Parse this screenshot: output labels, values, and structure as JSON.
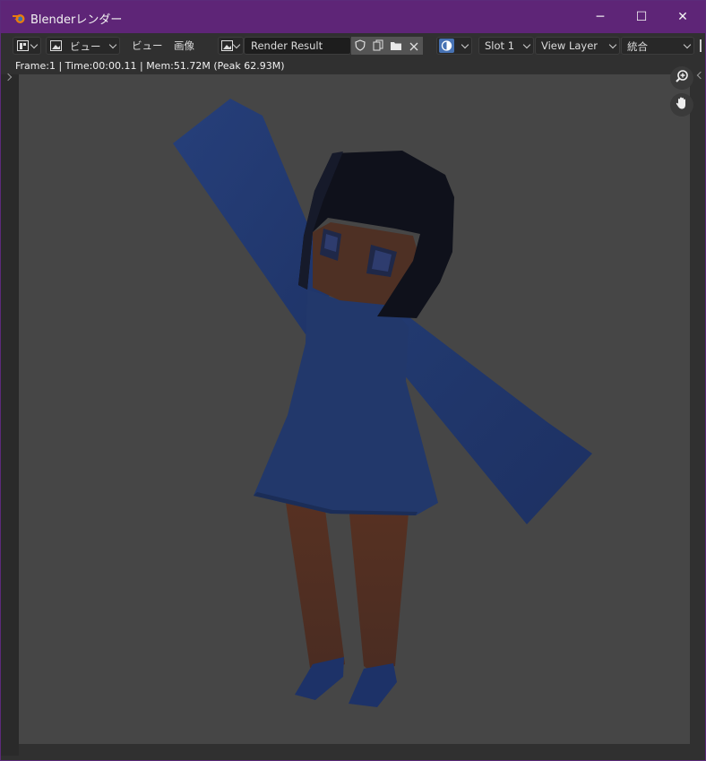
{
  "window": {
    "title": "Blenderレンダー",
    "controls": {
      "minimize": "─",
      "maximize": "☐",
      "close": "✕"
    }
  },
  "toolbar": {
    "view_dropdown": "ビュー",
    "view_menu": "ビュー",
    "image_menu": "画像",
    "image_name": "Render Result",
    "slot": "Slot 1",
    "view_layer": "View Layer",
    "pass": "統合"
  },
  "info": {
    "text": "Frame:1 | Time:00:00.11 | Mem:51.72M (Peak 62.93M)"
  },
  "colors": {
    "titlebar": "#5e2577",
    "viewport": "#464646",
    "dress": "#23386a",
    "skin": "#4e3024",
    "hair": "#0f111b"
  },
  "icons": {
    "app": "blender-icon",
    "zoom": "zoom-in-icon",
    "pan": "hand-icon"
  }
}
